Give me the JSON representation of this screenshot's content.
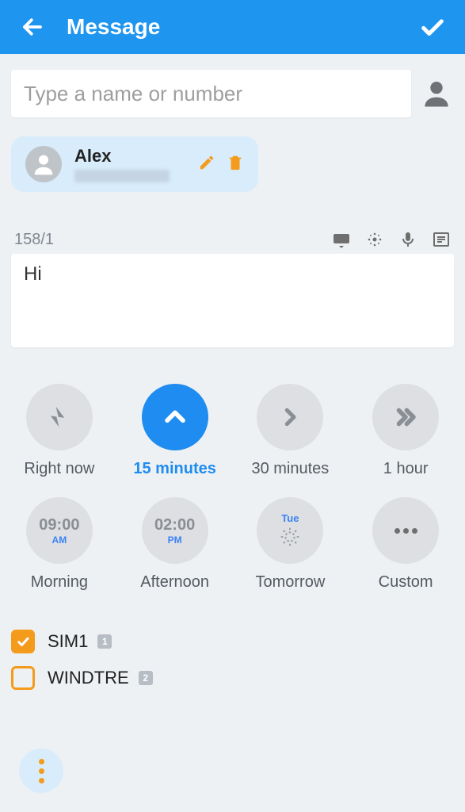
{
  "header": {
    "title": "Message"
  },
  "search": {
    "placeholder": "Type a name or number"
  },
  "recipient": {
    "name": "Alex"
  },
  "counter": "158/1",
  "message_text": "Hi",
  "schedule": [
    {
      "key": "now",
      "label": "Right now"
    },
    {
      "key": "15m",
      "label": "15 minutes"
    },
    {
      "key": "30m",
      "label": "30 minutes"
    },
    {
      "key": "1h",
      "label": "1 hour"
    },
    {
      "key": "morning",
      "label": "Morning",
      "time": "09:00",
      "ampm": "AM"
    },
    {
      "key": "afternoon",
      "label": "Afternoon",
      "time": "02:00",
      "ampm": "PM"
    },
    {
      "key": "tomorrow",
      "label": "Tomorrow",
      "day": "Tue"
    },
    {
      "key": "custom",
      "label": "Custom"
    }
  ],
  "sims": [
    {
      "name": "SIM1",
      "badge": "1",
      "checked": true
    },
    {
      "name": "WINDTRE",
      "badge": "2",
      "checked": false
    }
  ]
}
